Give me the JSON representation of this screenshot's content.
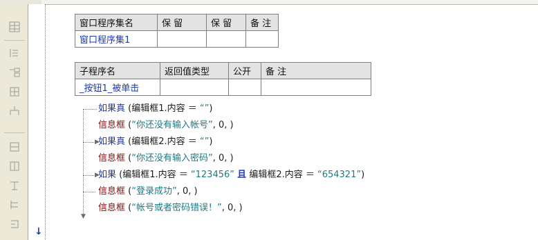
{
  "assembly_table": {
    "headers": [
      "窗口程序集名",
      "保 留",
      "保 留",
      "备 注"
    ],
    "row": [
      "窗口程序集1",
      "",
      "",
      ""
    ]
  },
  "sub_table": {
    "headers": [
      "子程序名",
      "返回值类型",
      "公开",
      "备 注"
    ],
    "row": [
      "_按钮1_被单击",
      "",
      "",
      ""
    ]
  },
  "code": {
    "line1": {
      "kw": "如果真",
      "cond": "(编辑框1.内容 ＝ ",
      "str": "“”",
      "end": ")"
    },
    "line2": {
      "kw": "信息框",
      "open": "(",
      "str": "“你还没有输入帐号”",
      "rest": ", 0, )"
    },
    "line3": {
      "kw": "如果真",
      "cond": "(编辑框2.内容 ＝ ",
      "str": "“”",
      "end": ")"
    },
    "line4": {
      "kw": "信息框",
      "open": "(",
      "str": "“你还没有输入密码”",
      "rest": ", 0, )"
    },
    "line5": {
      "kw": "如果",
      "cond1": "(编辑框1.内容 ＝ ",
      "str1": "“123456”",
      "and": "且",
      "cond2": "编辑框2.内容 ＝ ",
      "str2": "“654321”",
      "end": ")"
    },
    "line6": {
      "kw": "信息框",
      "open": "(",
      "str": "“登录成功”",
      "rest": ", 0, )"
    },
    "line7": {
      "kw": "信息框",
      "open": "(",
      "str": "“帐号或者密码错误！”",
      "rest": ", 0, )"
    }
  },
  "colors": {
    "keyword_flow": "#1f3aa8",
    "keyword_call": "#8a0c0c",
    "string": "#1c7a82"
  },
  "toolbar_icons": [
    "grid-icon",
    "insert-row-icon",
    "insert-sub-icon",
    "table-icon",
    "tree-icon",
    "frame-icon",
    "frame-split-icon",
    "text-icon",
    "branch-icon",
    "loop-icon"
  ]
}
